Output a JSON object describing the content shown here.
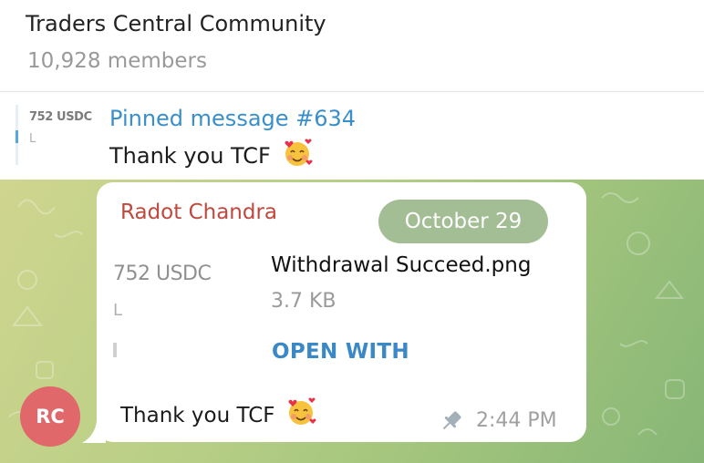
{
  "header": {
    "title": "Traders Central Community",
    "members": "10,928 members"
  },
  "pinned": {
    "thumb_line1": "752 USDC",
    "thumb_line2": "L",
    "title": "Pinned message #634",
    "text": "Thank you TCF",
    "emoji": "smiling-face-with-hearts-icon"
  },
  "message": {
    "avatar_initials": "RC",
    "avatar_color": "#e0676a",
    "sender": "Radot Chandra",
    "sender_color": "#c0483d",
    "date": "October 29",
    "file": {
      "thumb_line1": "752 USDC",
      "thumb_line2": "L",
      "name": "Withdrawal Succeed.png",
      "size": "3.7 KB",
      "action": "OPEN WITH"
    },
    "text": "Thank you TCF",
    "emoji": "smiling-face-with-hearts-icon",
    "pinned_icon": "pin-icon",
    "time": "2:44 PM"
  },
  "colors": {
    "accent": "#3a8fca",
    "link": "#3a88c6",
    "date_pill": "#a3bd94"
  }
}
